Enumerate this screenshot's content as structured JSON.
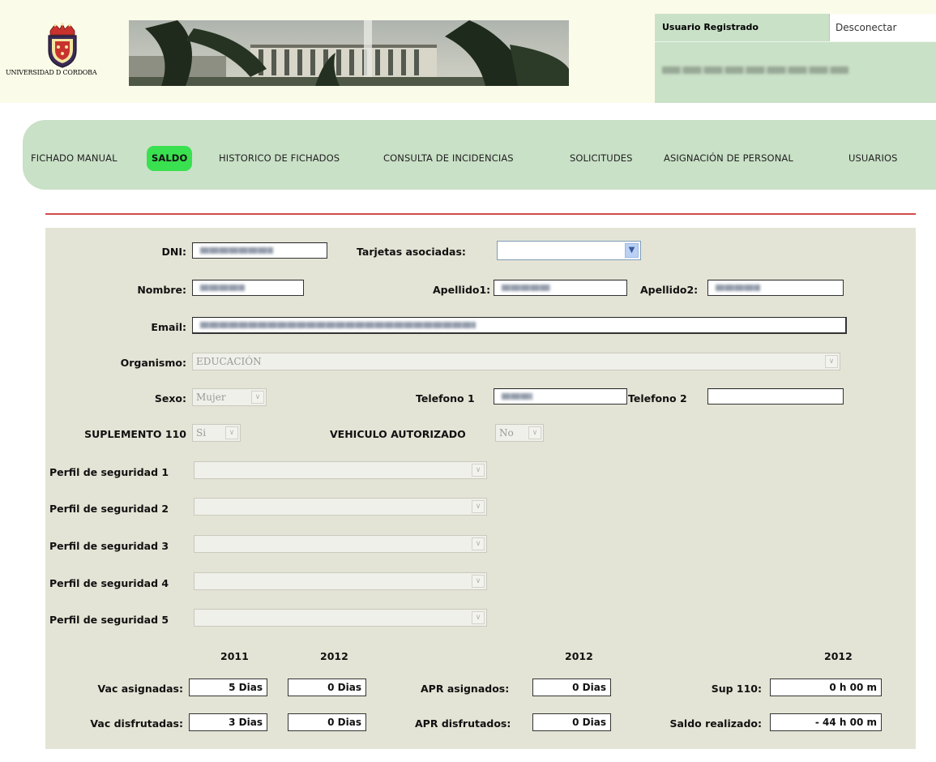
{
  "header": {
    "logo_text": "UNIVERSIDAD D CORDOBA",
    "user_label": "Usuario Registrado",
    "logout_label": "Desconectar"
  },
  "nav": {
    "items": [
      {
        "label": "FICHADO MANUAL"
      },
      {
        "label": "SALDO",
        "active": true
      },
      {
        "label": "HISTORICO DE FICHADOS"
      },
      {
        "label": "CONSULTA DE INCIDENCIAS"
      },
      {
        "label": "SOLICITUDES"
      },
      {
        "label": "ASIGNACIÓN DE PERSONAL"
      },
      {
        "label": "USUARIOS"
      }
    ]
  },
  "form": {
    "dni_label": "DNI:",
    "tarjetas_label": "Tarjetas asociadas:",
    "nombre_label": "Nombre:",
    "apellido1_label": "Apellido1:",
    "apellido2_label": "Apellido2:",
    "email_label": "Email:",
    "organismo_label": "Organismo:",
    "organismo_value": "EDUCACIÓN",
    "sexo_label": "Sexo:",
    "sexo_value": "Mujer",
    "telefono1_label": "Telefono 1",
    "telefono2_label": "Telefono 2",
    "suplemento_label": "SUPLEMENTO 110",
    "suplemento_value": "Si",
    "vehiculo_label": "VEHICULO AUTORIZADO",
    "vehiculo_value": "No",
    "perfiles": [
      {
        "label": "Perfil de seguridad 1"
      },
      {
        "label": "Perfil de seguridad 2"
      },
      {
        "label": "Perfil de seguridad 3"
      },
      {
        "label": "Perfil de seguridad 4"
      },
      {
        "label": "Perfil de seguridad 5"
      }
    ]
  },
  "balance": {
    "years": {
      "vac_y1": "2011",
      "vac_y2": "2012",
      "apr_y": "2012",
      "sup_y": "2012"
    },
    "vac_asignadas_label": "Vac asignadas:",
    "vac_asignadas_2011": "5 Dias",
    "vac_asignadas_2012": "0 Dias",
    "vac_disfrutadas_label": "Vac disfrutadas:",
    "vac_disfrutadas_2011": "3 Dias",
    "vac_disfrutadas_2012": "0 Dias",
    "apr_asignados_label": "APR asignados:",
    "apr_asignados_value": "0 Dias",
    "apr_disfrutados_label": "APR disfrutados:",
    "apr_disfrutados_value": "0 Dias",
    "sup110_label": "Sup 110:",
    "sup110_value": "0 h 00 m",
    "saldo_label": "Saldo realizado:",
    "saldo_value": "- 44 h 00 m"
  },
  "colors": {
    "header_bg": "#fbfbe9",
    "panel_green": "#c9e1c7",
    "active_tab": "#39e04f",
    "form_bg": "#e4e4d6",
    "rule_red": "#d44a4a"
  }
}
